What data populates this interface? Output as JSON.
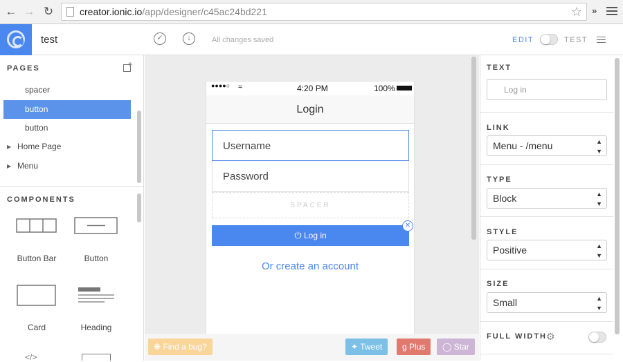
{
  "browser": {
    "url_host": "creator.ionic.io",
    "url_path": "/app/designer/c45ac24bd221"
  },
  "header": {
    "project_name": "test",
    "save_status": "All changes saved",
    "edit_label": "EDIT",
    "test_label": "TEST"
  },
  "pages": {
    "title": "PAGES",
    "items": [
      {
        "label": "spacer",
        "selected": false,
        "expandable": false
      },
      {
        "label": "button",
        "selected": true,
        "expandable": false
      },
      {
        "label": "button",
        "selected": false,
        "expandable": false
      },
      {
        "label": "Home Page",
        "selected": false,
        "expandable": true
      },
      {
        "label": "Menu",
        "selected": false,
        "expandable": true
      }
    ]
  },
  "components": {
    "title": "COMPONENTS",
    "items": [
      {
        "label": "Button Bar"
      },
      {
        "label": "Button"
      },
      {
        "label": "Card"
      },
      {
        "label": "Heading"
      }
    ]
  },
  "phone": {
    "time": "4:20 PM",
    "battery": "100%",
    "title": "Login",
    "username_placeholder": "Username",
    "password_placeholder": "Password",
    "spacer_label": "SPACER",
    "login_button": "Log in",
    "create_account_link": "Or create an account"
  },
  "footer": {
    "bug_label": "Find a bug?",
    "tweet_label": "Tweet",
    "plus_label": "Plus",
    "star_label": "Star"
  },
  "properties": {
    "text_title": "TEXT",
    "text_placeholder": "Log in",
    "link_title": "LINK",
    "link_value": "Menu - /menu",
    "type_title": "TYPE",
    "type_value": "Block",
    "style_title": "STYLE",
    "style_value": "Positive",
    "size_title": "SIZE",
    "size_value": "Small",
    "full_width_title": "FULL WIDTH"
  },
  "colors": {
    "accent": "#4a87ee",
    "bug": "#f9d59a",
    "tweet": "#7cc0e8",
    "plus": "#e07a6f",
    "star": "#cdb5d6"
  }
}
